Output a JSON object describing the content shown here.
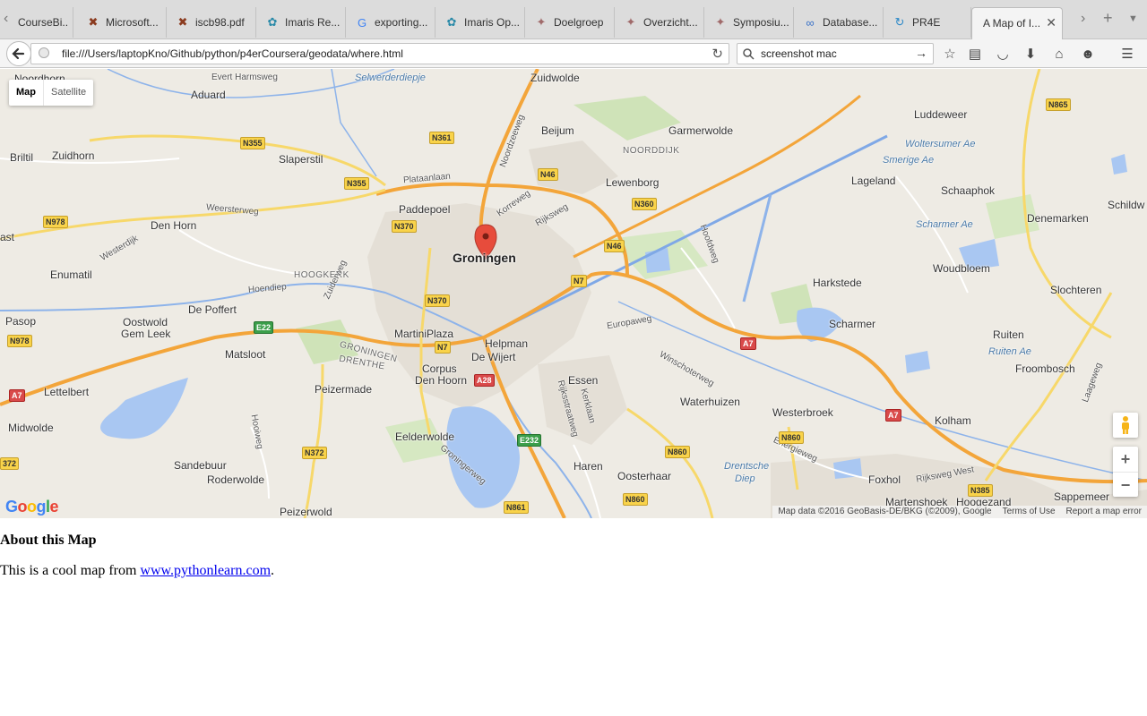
{
  "browser": {
    "tabs": [
      {
        "label": "CourseBi...",
        "icon": "course-icon"
      },
      {
        "label": "Microsoft...",
        "icon": "document-icon"
      },
      {
        "label": "iscb98.pdf",
        "icon": "document-icon"
      },
      {
        "label": "Imaris Re...",
        "icon": "imaris-icon"
      },
      {
        "label": "exporting...",
        "icon": "google-icon"
      },
      {
        "label": "Imaris Op...",
        "icon": "imaris-icon"
      },
      {
        "label": "Doelgroep",
        "icon": "star-icon"
      },
      {
        "label": "Overzicht...",
        "icon": "star-icon"
      },
      {
        "label": "Symposiu...",
        "icon": "star-icon"
      },
      {
        "label": "Database...",
        "icon": "link-icon"
      },
      {
        "label": "PR4E",
        "icon": "refresh-icon"
      }
    ],
    "active_tab": "A Map of I...",
    "url": "file:///Users/laptopKno/Github/python/p4erCoursera/geodata/where.html",
    "search": "screenshot mac"
  },
  "map": {
    "type_buttons": {
      "map": "Map",
      "satellite": "Satellite"
    },
    "marker_city": "Groningen",
    "places": [
      {
        "t": "Noordhorn",
        "c": ""
      },
      {
        "t": "Aduard",
        "c": ""
      },
      {
        "t": "Zuidwolde",
        "c": ""
      },
      {
        "t": "Beijum",
        "c": ""
      },
      {
        "t": "Garmerwolde",
        "c": ""
      },
      {
        "t": "Luddeweer",
        "c": ""
      },
      {
        "t": "Briltil",
        "c": ""
      },
      {
        "t": "Zuidhorn",
        "c": ""
      },
      {
        "t": "Slaperstil",
        "c": ""
      },
      {
        "t": "Lewenborg",
        "c": ""
      },
      {
        "t": "Lageland",
        "c": ""
      },
      {
        "t": "Schaaphok",
        "c": ""
      },
      {
        "t": "Paddepoel",
        "c": ""
      },
      {
        "t": "Den Horn",
        "c": ""
      },
      {
        "t": "Denemarken",
        "c": ""
      },
      {
        "t": "Enumatil",
        "c": ""
      },
      {
        "t": "Woudbloem",
        "c": ""
      },
      {
        "t": "Harkstede",
        "c": ""
      },
      {
        "t": "Slochteren",
        "c": ""
      },
      {
        "t": "De Poffert",
        "c": ""
      },
      {
        "t": "Pasop",
        "c": ""
      },
      {
        "t": "Oostwold",
        "c": ""
      },
      {
        "t": "Gem Leek",
        "c": ""
      },
      {
        "t": "MartiniPlaza",
        "c": ""
      },
      {
        "t": "Scharmer",
        "c": ""
      },
      {
        "t": "Helpman",
        "c": ""
      },
      {
        "t": "De Wijert",
        "c": ""
      },
      {
        "t": "Ruiten",
        "c": ""
      },
      {
        "t": "Matsloot",
        "c": ""
      },
      {
        "t": "Corpus",
        "c": ""
      },
      {
        "t": "Den Hoorn",
        "c": ""
      },
      {
        "t": "Froombosch",
        "c": ""
      },
      {
        "t": "Lettelbert",
        "c": ""
      },
      {
        "t": "Peizermade",
        "c": ""
      },
      {
        "t": "Essen",
        "c": ""
      },
      {
        "t": "Waterhuizen",
        "c": ""
      },
      {
        "t": "Westerbroek",
        "c": ""
      },
      {
        "t": "Kolham",
        "c": ""
      },
      {
        "t": "Midwolde",
        "c": ""
      },
      {
        "t": "Eelderwolde",
        "c": ""
      },
      {
        "t": "Sandebuur",
        "c": ""
      },
      {
        "t": "Haren",
        "c": ""
      },
      {
        "t": "Oosterhaar",
        "c": ""
      },
      {
        "t": "Roderwolde",
        "c": ""
      },
      {
        "t": "Foxhol",
        "c": ""
      },
      {
        "t": "Martenshoek",
        "c": ""
      },
      {
        "t": "Hoogezand",
        "c": ""
      },
      {
        "t": "Sappemeer",
        "c": ""
      },
      {
        "t": "Peizerwold",
        "c": ""
      },
      {
        "t": "Schildw",
        "c": ""
      },
      {
        "t": "ast",
        "c": ""
      },
      {
        "t": "NOORDDIJK",
        "c": "caps"
      },
      {
        "t": "HOOGKERK",
        "c": "caps"
      },
      {
        "t": "GRONINGEN",
        "c": "caps"
      },
      {
        "t": "DRENTHE",
        "c": "caps"
      },
      {
        "t": "Selwerderdiepje",
        "c": "it"
      },
      {
        "t": "Woltersumer Ae",
        "c": "it"
      },
      {
        "t": "Smerige Ae",
        "c": "it"
      },
      {
        "t": "Scharmer Ae",
        "c": "it"
      },
      {
        "t": "Ruiten Ae",
        "c": "it"
      },
      {
        "t": "Drentsche",
        "c": "it"
      },
      {
        "t": "Diep",
        "c": "it"
      },
      {
        "t": "Evert Harmsweg",
        "c": "road"
      },
      {
        "t": "Plataanlaan",
        "c": "road"
      },
      {
        "t": "Noordzeeweg",
        "c": "road"
      },
      {
        "t": "Korreweg",
        "c": "road"
      },
      {
        "t": "Rijksweg",
        "c": "road"
      },
      {
        "t": "Weersterweg",
        "c": "road"
      },
      {
        "t": "Westerdijk",
        "c": "road"
      },
      {
        "t": "Hoendiep",
        "c": "road"
      },
      {
        "t": "Zuiderweg",
        "c": "road"
      },
      {
        "t": "Europaweg",
        "c": "road"
      },
      {
        "t": "Winschoterweg",
        "c": "road"
      },
      {
        "t": "Hoofdweg",
        "c": "road"
      },
      {
        "t": "Kerklaan",
        "c": "road"
      },
      {
        "t": "Rijksstraatweg",
        "c": "road"
      },
      {
        "t": "Groningerweg",
        "c": "road"
      },
      {
        "t": "Energieweg",
        "c": "road"
      },
      {
        "t": "Rijksweg West",
        "c": "road"
      },
      {
        "t": "Hooiweg",
        "c": "road"
      },
      {
        "t": "Laageweg",
        "c": "road"
      }
    ],
    "shields": [
      {
        "t": "N361",
        "k": "n"
      },
      {
        "t": "N355",
        "k": "n"
      },
      {
        "t": "N355",
        "k": "n"
      },
      {
        "t": "N46",
        "k": "n"
      },
      {
        "t": "N360",
        "k": "n"
      },
      {
        "t": "N978",
        "k": "n"
      },
      {
        "t": "N370",
        "k": "n"
      },
      {
        "t": "N46",
        "k": "n"
      },
      {
        "t": "N865",
        "k": "n"
      },
      {
        "t": "N7",
        "k": "n"
      },
      {
        "t": "N370",
        "k": "n"
      },
      {
        "t": "E22",
        "k": "e"
      },
      {
        "t": "N978",
        "k": "n"
      },
      {
        "t": "N7",
        "k": "n"
      },
      {
        "t": "A7",
        "k": "a"
      },
      {
        "t": "A7",
        "k": "a"
      },
      {
        "t": "A28",
        "k": "a"
      },
      {
        "t": "A7",
        "k": "a"
      },
      {
        "t": "E232",
        "k": "e"
      },
      {
        "t": "N372",
        "k": "n"
      },
      {
        "t": "N860",
        "k": "n"
      },
      {
        "t": "N860",
        "k": "n"
      },
      {
        "t": "N860",
        "k": "n"
      },
      {
        "t": "N861",
        "k": "n"
      },
      {
        "t": "N385",
        "k": "n"
      },
      {
        "t": "372",
        "k": "n"
      }
    ],
    "attribution": {
      "data": "Map data ©2016 GeoBasis-DE/BKG (©2009), Google",
      "terms": "Terms of Use",
      "report": "Report a map error"
    },
    "zoom_in": "+",
    "zoom_out": "−",
    "logo": "Google"
  },
  "content": {
    "heading": "About this Map",
    "text_before": "This is a cool map from ",
    "link": "www.pythonlearn.com",
    "text_after": "."
  }
}
